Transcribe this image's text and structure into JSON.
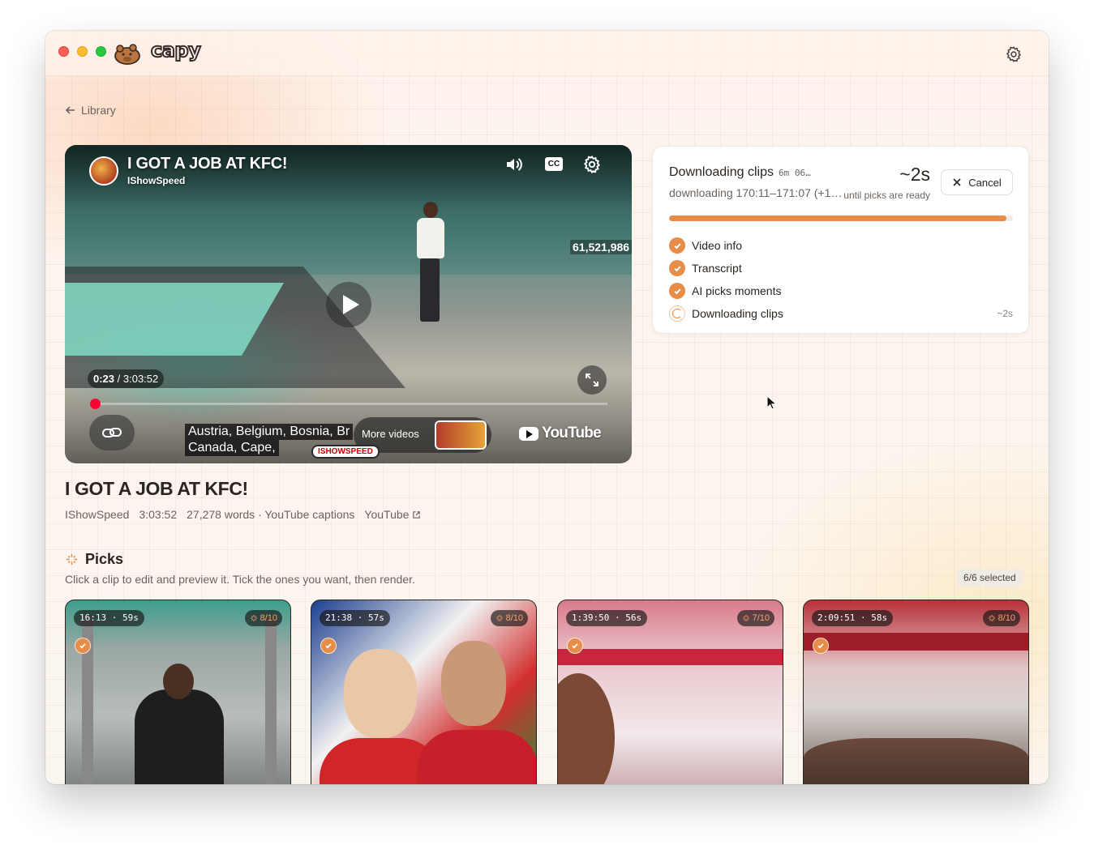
{
  "app": {
    "logo_text": "capy"
  },
  "nav": {
    "back_label": "Library"
  },
  "player": {
    "title_overlay": "I GOT A JOB AT KFC!",
    "channel_overlay": "IShowSpeed",
    "cc_label": "CC",
    "view_count": "61,521,986",
    "current_time": "0:23",
    "duration": "3:03:52",
    "progress": 0.0021,
    "caption_line1": "Austria, Belgium, Bosnia, Br",
    "caption_line2": "Canada, Cape,",
    "more_videos_label": "More videos",
    "youtube_watermark": "YouTube",
    "channel_badge": "ISHOWSPEED"
  },
  "video": {
    "title": "I GOT A JOB AT KFC!",
    "channel": "IShowSpeed",
    "duration": "3:03:52",
    "words_source": "27,278 words · YouTube captions",
    "youtube_link": "YouTube"
  },
  "progress": {
    "title": "Downloading clips",
    "title_suffix": "6m 06…",
    "subtitle": "downloading 170:11–171:07 (+1…",
    "eta": "~2s",
    "eta_sub": "until picks are ready",
    "cancel_label": "Cancel",
    "fraction": 0.98,
    "accent": "#e78d47",
    "steps": [
      {
        "label": "Video info",
        "status": "done",
        "eta": ""
      },
      {
        "label": "Transcript",
        "status": "done",
        "eta": ""
      },
      {
        "label": "AI picks moments",
        "status": "done",
        "eta": ""
      },
      {
        "label": "Downloading clips",
        "status": "active",
        "eta": "~2s"
      }
    ]
  },
  "picks": {
    "heading": "Picks",
    "subtitle": "Click a clip to edit and preview it. Tick the ones you want, then render.",
    "selected_count": "6/6 selected",
    "clips": [
      {
        "time": "16:13 · 59s",
        "score": "8/10",
        "selected": true
      },
      {
        "time": "21:38 · 57s",
        "score": "8/10",
        "selected": true
      },
      {
        "time": "1:39:50 · 56s",
        "score": "7/10",
        "selected": true
      },
      {
        "time": "2:09:51 · 58s",
        "score": "8/10",
        "selected": true
      }
    ]
  }
}
